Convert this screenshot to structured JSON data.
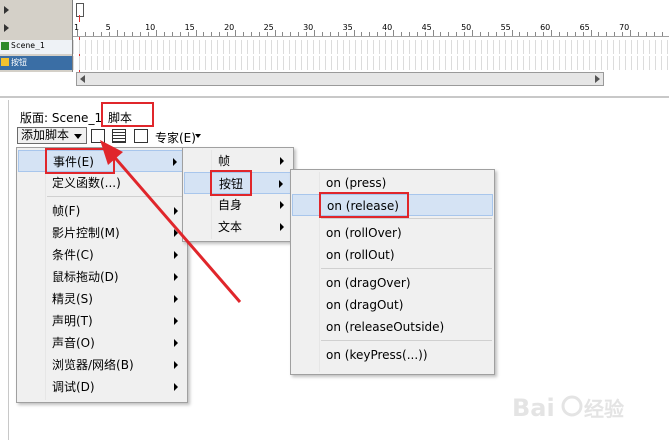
{
  "timeline": {
    "ruler_numbers": [
      "1",
      "5",
      "10",
      "15",
      "20",
      "25",
      "30",
      "35",
      "40",
      "45",
      "50",
      "55",
      "60",
      "65",
      "70"
    ],
    "layers": [
      {
        "name": "Scene_1"
      },
      {
        "name": "按钮"
      }
    ]
  },
  "panel": {
    "location_label": "版面: Scene_1",
    "script_tab": "脚本",
    "add_script_label": "添加脚本",
    "expert_label": "专家(E)"
  },
  "menus": {
    "main": [
      {
        "label": "事件(E)",
        "submenu": true
      },
      {
        "label": "定义函数(...)",
        "submenu": false
      },
      {
        "label": "帧(F)",
        "submenu": true
      },
      {
        "label": "影片控制(M)",
        "submenu": true
      },
      {
        "label": "条件(C)",
        "submenu": true
      },
      {
        "label": "鼠标拖动(D)",
        "submenu": true
      },
      {
        "label": "精灵(S)",
        "submenu": true
      },
      {
        "label": "声明(T)",
        "submenu": true
      },
      {
        "label": "声音(O)",
        "submenu": true
      },
      {
        "label": "浏览器/网络(B)",
        "submenu": true
      },
      {
        "label": "调试(D)",
        "submenu": true
      }
    ],
    "events": [
      {
        "label": "帧"
      },
      {
        "label": "按钮"
      },
      {
        "label": "自身"
      },
      {
        "label": "文本"
      }
    ],
    "button_events": [
      {
        "label": "on (press)"
      },
      {
        "label": "on (release)"
      },
      {
        "label": "on (rollOver)"
      },
      {
        "label": "on (rollOut)"
      },
      {
        "label": "on (dragOver)"
      },
      {
        "label": "on (dragOut)"
      },
      {
        "label": "on (releaseOutside)"
      },
      {
        "label": "on (keyPress(...))"
      }
    ]
  },
  "colors": {
    "highlight_box": "#e0262b",
    "menu_highlight": "#d5e3f4"
  }
}
